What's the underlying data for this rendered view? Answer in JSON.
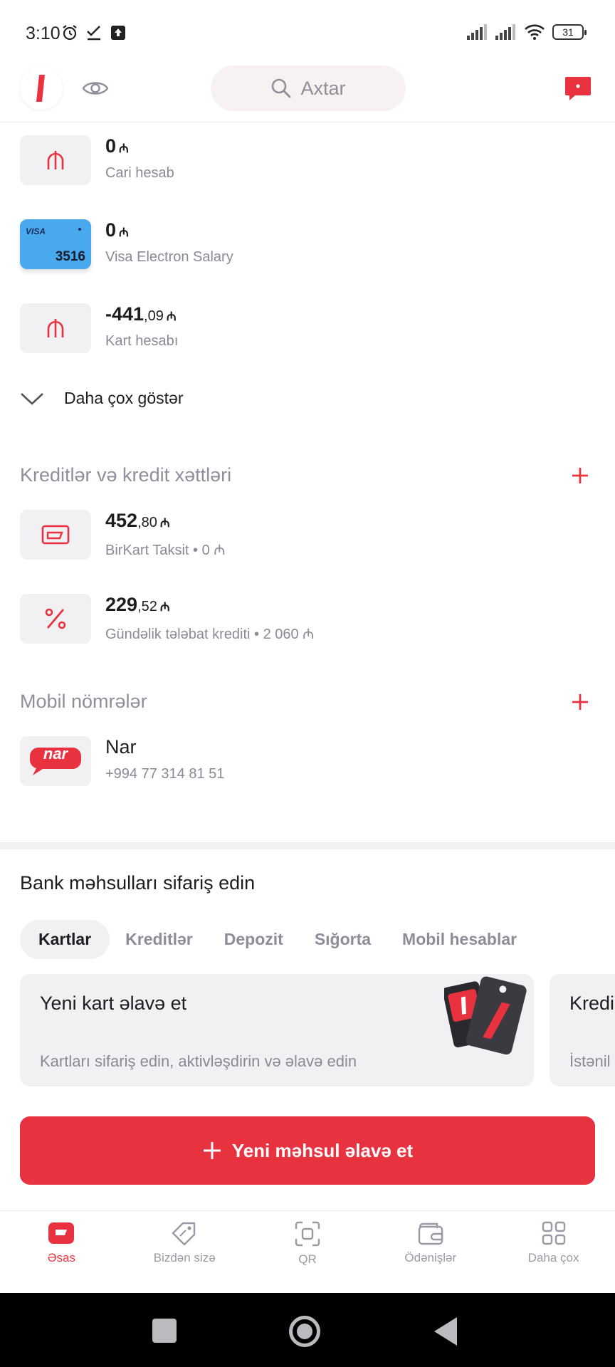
{
  "status_bar": {
    "time": "3:10",
    "battery": "31"
  },
  "header": {
    "search_placeholder": "Axtar"
  },
  "accounts": [
    {
      "int": "0",
      "dec": "",
      "currency": "₼",
      "name": "Cari hesab"
    },
    {
      "int": "0",
      "dec": "",
      "currency": "₼",
      "name": "Visa Electron Salary",
      "card_brand": "VISA",
      "card_last4": "3516"
    },
    {
      "int": "-441",
      "dec": ",09",
      "currency": "₼",
      "name": "Kart hesabı"
    }
  ],
  "show_more": "Daha çox göstər",
  "loans_section": {
    "title": "Kreditlər və kredit xəttləri",
    "items": [
      {
        "int": "452",
        "dec": ",80",
        "currency": "₼",
        "name": "BirKart Taksit",
        "extra": "0 ₼"
      },
      {
        "int": "229",
        "dec": ",52",
        "currency": "₼",
        "name": "Gündəlik tələbat krediti",
        "extra": "2 060 ₼"
      }
    ]
  },
  "mobile_section": {
    "title": "Mobil nömrələr",
    "items": [
      {
        "name": "Nar",
        "phone": "+994 77 314 81 51",
        "logo_text": "nar"
      }
    ]
  },
  "order_section": {
    "title": "Bank məhsulları sifariş edin",
    "tabs": [
      "Kartlar",
      "Kreditlər",
      "Depozit",
      "Sığorta",
      "Mobil hesablar"
    ],
    "active_tab": "Kartlar",
    "cards": [
      {
        "title": "Yeni kart əlavə et",
        "subtitle": "Kartları sifariş edin, aktivləşdirin və əlavə edin"
      },
      {
        "title": "Kredi",
        "subtitle": "İstənil"
      }
    ]
  },
  "cta": {
    "label": "Yeni məhsul əlavə et"
  },
  "bottom_nav": [
    {
      "label": "Əsas",
      "icon": "home-icon",
      "active": true
    },
    {
      "label": "Bizdən sizə",
      "icon": "tag-icon",
      "active": false
    },
    {
      "label": "QR",
      "icon": "qr-scan-icon",
      "active": false
    },
    {
      "label": "Ödənişlər",
      "icon": "wallet-icon",
      "active": false
    },
    {
      "label": "Daha çox",
      "icon": "grid-icon",
      "active": false
    }
  ],
  "colors": {
    "accent": "#e9323f",
    "muted": "#8f8f9c",
    "tile": "#f1f1f3",
    "visa": "#48a9ee"
  }
}
